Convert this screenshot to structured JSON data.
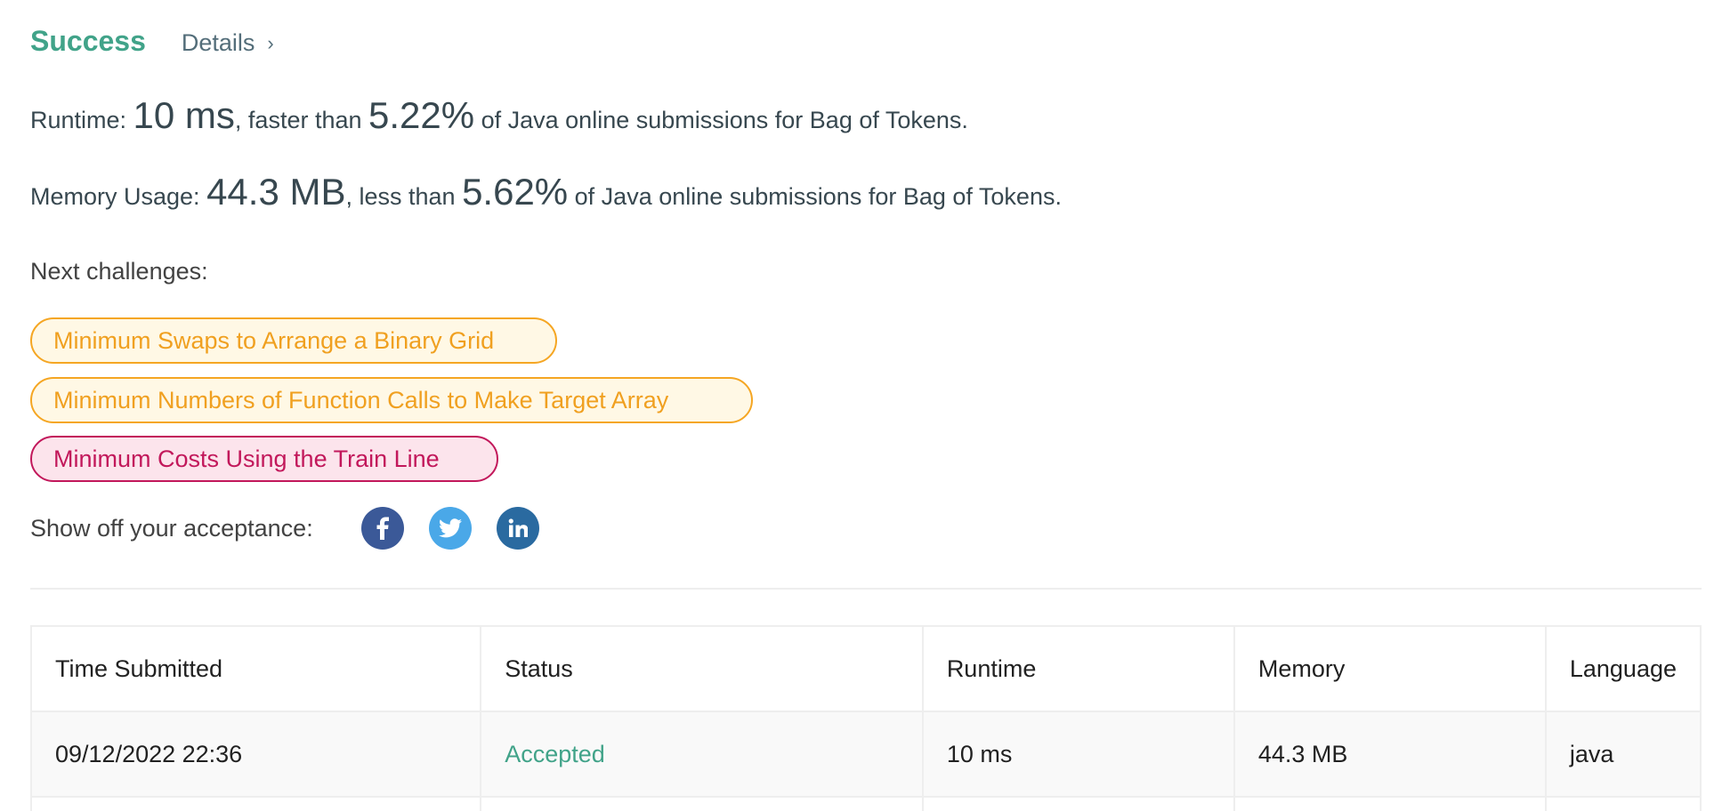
{
  "result": {
    "status": "Success",
    "details_label": "Details",
    "details_chevron": "›"
  },
  "runtime_line": {
    "label": "Runtime: ",
    "value": "10 ms",
    "middle": ", faster than ",
    "percent": "5.22%",
    "suffix": " of Java online submissions for Bag of Tokens."
  },
  "memory_line": {
    "label": "Memory Usage: ",
    "value": "44.3 MB",
    "middle": ", less than ",
    "percent": "5.62%",
    "suffix": " of Java online submissions for Bag of Tokens."
  },
  "next_challenges": {
    "label": "Next challenges:",
    "items": [
      {
        "title": "Minimum Swaps to Arrange a Binary Grid",
        "difficulty": "medium"
      },
      {
        "title": "Minimum Numbers of Function Calls to Make Target Array",
        "difficulty": "medium"
      },
      {
        "title": "Minimum Costs Using the Train Line",
        "difficulty": "hard"
      }
    ]
  },
  "share": {
    "label": "Show off your acceptance:",
    "icons": [
      "facebook-icon",
      "twitter-icon",
      "linkedin-icon"
    ]
  },
  "colors": {
    "success": "#41a389",
    "medium": "#f5a623",
    "hard": "#c2185b",
    "facebook": "#3b5998",
    "twitter": "#4aa8e8",
    "linkedin": "#2a6aa0"
  },
  "submissions": {
    "headers": [
      "Time Submitted",
      "Status",
      "Runtime",
      "Memory",
      "Language"
    ],
    "rows": [
      {
        "time": "09/12/2022 22:36",
        "status": "Accepted",
        "runtime": "10 ms",
        "memory": "44.3 MB",
        "language": "java"
      }
    ]
  }
}
